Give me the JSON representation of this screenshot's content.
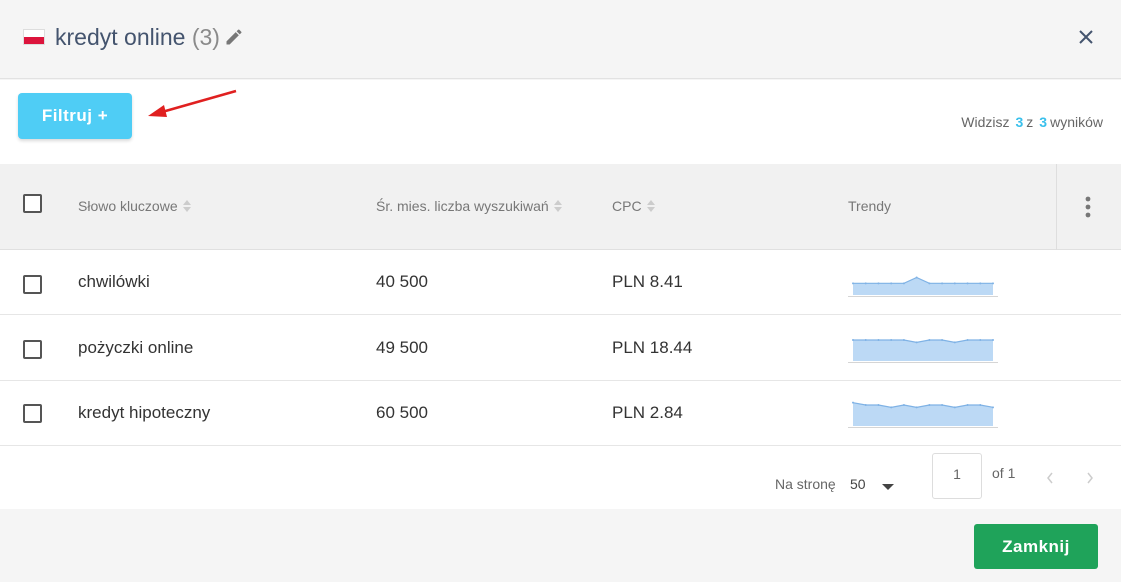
{
  "header": {
    "title": "kredyt online",
    "count": "(3)",
    "flag_colors": [
      "#ffffff",
      "#dc143c"
    ]
  },
  "toolbar": {
    "filter_label": "Filtruj +",
    "results_prefix": "Widzisz",
    "results_shown": "3",
    "results_sep": "z",
    "results_total": "3",
    "results_suffix": "wyników"
  },
  "table": {
    "columns": [
      "Słowo kluczowe",
      "Śr. mies. liczba wyszukiwań",
      "CPC",
      "Trendy"
    ],
    "rows": [
      {
        "keyword": "chwilówki",
        "volume": "40 500",
        "cpc": "PLN 8.41",
        "trend": [
          10,
          10,
          10,
          10,
          10,
          15,
          10,
          10,
          10,
          10,
          10,
          10
        ]
      },
      {
        "keyword": "pożyczki online",
        "volume": "49 500",
        "cpc": "PLN 18.44",
        "trend": [
          18,
          18,
          18,
          18,
          18,
          16,
          18,
          18,
          16,
          18,
          18,
          18
        ]
      },
      {
        "keyword": "kredyt hipoteczny",
        "volume": "60 500",
        "cpc": "PLN 2.84",
        "trend": [
          20,
          18,
          18,
          16,
          18,
          16,
          18,
          18,
          16,
          18,
          18,
          16
        ]
      }
    ]
  },
  "pagination": {
    "per_page_label": "Na stronę",
    "per_page_value": "50",
    "current_page": "1",
    "of_label": "of 1"
  },
  "footer": {
    "close_label": "Zamknij"
  },
  "colors": {
    "accent": "#4fcdf5",
    "primary": "#1fa35a",
    "trend_fill": "#bcd9f5",
    "trend_line": "#7fb2e5",
    "arrow": "#e02020"
  }
}
